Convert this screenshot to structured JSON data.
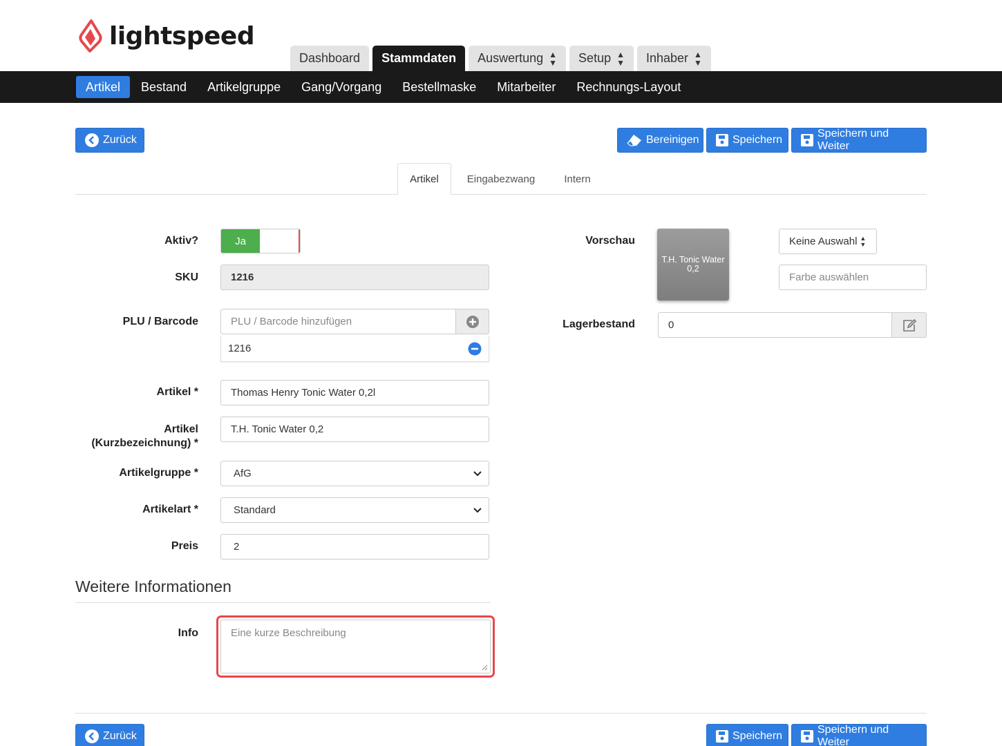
{
  "brand": {
    "name": "lightspeed",
    "color": "#e5484d"
  },
  "top_tabs": [
    {
      "label": "Dashboard",
      "dropdown": false
    },
    {
      "label": "Stammdaten",
      "dropdown": false,
      "active": true
    },
    {
      "label": "Auswertung",
      "dropdown": true
    },
    {
      "label": "Setup",
      "dropdown": true
    },
    {
      "label": "Inhaber",
      "dropdown": true
    }
  ],
  "nav": [
    {
      "label": "Artikel",
      "active": true
    },
    {
      "label": "Bestand"
    },
    {
      "label": "Artikelgruppe"
    },
    {
      "label": "Gang/Vorgang"
    },
    {
      "label": "Bestellmaske"
    },
    {
      "label": "Mitarbeiter"
    },
    {
      "label": "Rechnungs-Layout"
    }
  ],
  "toolbar": {
    "back": "Zurück",
    "clean": "Bereinigen",
    "save": "Speichern",
    "save_next": "Speichern und Weiter"
  },
  "form_tabs": [
    "Artikel",
    "Eingabezwang",
    "Intern"
  ],
  "form": {
    "active_label": "Aktiv?",
    "active_value": "Ja",
    "sku_label": "SKU",
    "sku_value": "1216",
    "plu_label": "PLU / Barcode",
    "plu_placeholder": "PLU / Barcode hinzufügen",
    "plu_entry": "1216",
    "article_label": "Artikel *",
    "article_value": "Thomas Henry Tonic Water 0,2l",
    "short_label_1": "Artikel",
    "short_label_2": "(Kurzbezeichnung) *",
    "short_value": "T.H. Tonic Water 0,2",
    "group_label": "Artikelgruppe *",
    "group_value": "AfG",
    "type_label": "Artikelart *",
    "type_value": "Standard",
    "price_label": "Preis",
    "price_value": "2"
  },
  "more_info": {
    "title": "Weitere Informationen",
    "info_label": "Info",
    "info_placeholder": "Eine kurze Beschreibung"
  },
  "right": {
    "preview_label": "Vorschau",
    "preview_text": "T.H. Tonic Water 0,2",
    "color_select": "Keine Auswahl",
    "color_placeholder": "Farbe auswählen",
    "stock_label": "Lagerbestand",
    "stock_value": "0"
  },
  "colors": {
    "primary": "#2f7de1",
    "success": "#4cae4c",
    "highlight": "#e5484d",
    "navbar": "#1a1a1a"
  }
}
